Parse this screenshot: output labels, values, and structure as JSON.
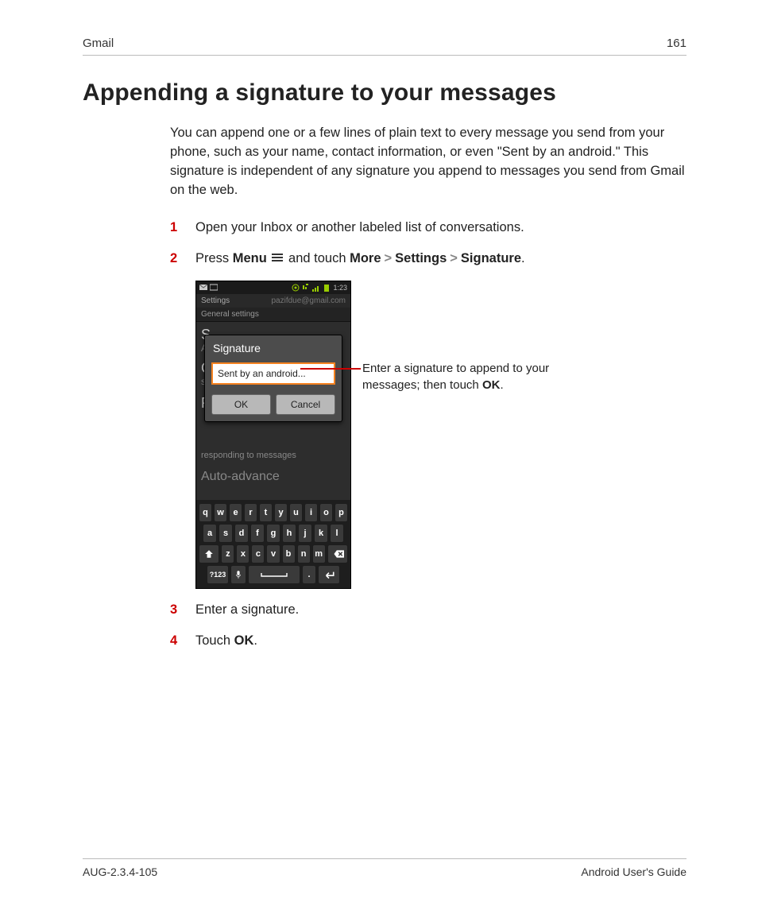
{
  "header": {
    "section": "Gmail",
    "page_number": "161"
  },
  "title": "Appending a signature to your messages",
  "intro": "You can append one or a few lines of plain text to every message you send from your phone, such as your name, contact information, or even \"Sent by an android.\" This signature is independent of any signature you append to messages you send from Gmail on the web.",
  "steps": {
    "s1": "Open your Inbox or another labeled list of conversations.",
    "s2_prefix": "Press ",
    "s2_menu_word": "Menu",
    "s2_mid": " and touch ",
    "s2_more": "More",
    "s2_settings": "Settings",
    "s2_signature": "Signature",
    "s3": "Enter a signature.",
    "s4_prefix": "Touch ",
    "s4_ok": "OK"
  },
  "annotation": {
    "text_a": "Enter a signature to append to your",
    "text_b": "messages; then touch ",
    "ok": "OK",
    "period": "."
  },
  "phone": {
    "statusbar": {
      "time": "1:23"
    },
    "titlebar": {
      "left": "Settings",
      "right": "pazifdue@gmail.com"
    },
    "subbar": "General settings",
    "bg": {
      "si": "S",
      "ad": "Ad",
      "c": "C",
      "s2": "s",
      "r": "R",
      "reply_desc": "responding to messages",
      "auto": "Auto-advance"
    },
    "dialog": {
      "title": "Signature",
      "input": "Sent by an android...",
      "ok": "OK",
      "cancel": "Cancel"
    },
    "keyboard": {
      "row1": [
        "q",
        "w",
        "e",
        "r",
        "t",
        "y",
        "u",
        "i",
        "o",
        "p"
      ],
      "row2": [
        "a",
        "s",
        "d",
        "f",
        "g",
        "h",
        "j",
        "k",
        "l"
      ],
      "row3_mid": [
        "z",
        "x",
        "c",
        "v",
        "b",
        "n",
        "m"
      ],
      "sym": "?123",
      "period": "."
    }
  },
  "footer": {
    "left": "AUG-2.3.4-105",
    "right": "Android User's Guide"
  }
}
